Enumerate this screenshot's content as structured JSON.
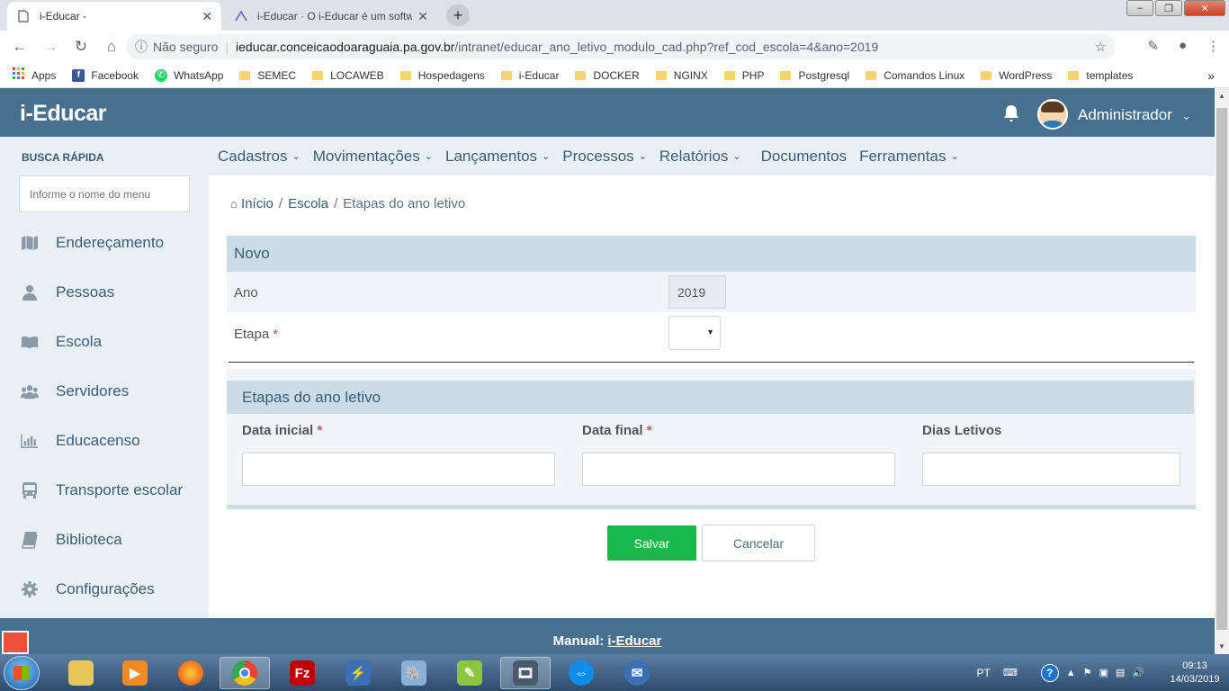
{
  "browser": {
    "tabs": [
      {
        "title": "i-Educar -"
      },
      {
        "title": "i-Educar · O i-Educar é um softwa"
      }
    ],
    "address": {
      "security_label": "Não seguro",
      "host": "ieducar.conceicaodoaraguaia.pa.gov.br",
      "path": "/intranet/educar_ano_letivo_modulo_cad.php?ref_cod_escola=4&ano=2019"
    },
    "bookmarks": [
      "Apps",
      "Facebook",
      "WhatsApp",
      "SEMEC",
      "LOCAWEB",
      "Hospedagens",
      "i-Educar",
      "DOCKER",
      "NGINX",
      "PHP",
      "Postgresql",
      "Comandos Linux",
      "WordPress",
      "templates"
    ]
  },
  "app": {
    "logo": "i-Educar",
    "user_name": "Administrador"
  },
  "sidebar": {
    "search_label": "BUSCA RÁPIDA",
    "search_placeholder": "Informe o nome do menu",
    "items": [
      {
        "label": "Endereçamento",
        "icon": "map-icon"
      },
      {
        "label": "Pessoas",
        "icon": "person-icon"
      },
      {
        "label": "Escola",
        "icon": "book-icon"
      },
      {
        "label": "Servidores",
        "icon": "users-icon"
      },
      {
        "label": "Educacenso",
        "icon": "bar-chart-icon"
      },
      {
        "label": "Transporte escolar",
        "icon": "bus-icon"
      },
      {
        "label": "Biblioteca",
        "icon": "library-book-icon"
      },
      {
        "label": "Configurações",
        "icon": "gear-icon"
      }
    ]
  },
  "menu": [
    "Cadastros",
    "Movimentações",
    "Lançamentos",
    "Processos",
    "Relatórios",
    "Documentos",
    "Ferramentas"
  ],
  "breadcrumb": {
    "home": "Início",
    "level1": "Escola",
    "current": "Etapas do ano letivo"
  },
  "form": {
    "section_title": "Novo",
    "ano_label": "Ano",
    "ano_value": "2019",
    "etapa_label": "Etapa",
    "required_mark": "*",
    "etapas_title": "Etapas do ano letivo",
    "col_data_inicial": "Data inicial",
    "col_data_final": "Data final",
    "col_dias_letivos": "Dias Letivos",
    "save_label": "Salvar",
    "cancel_label": "Cancelar"
  },
  "footer": {
    "prefix": "Manual:",
    "link": "i-Educar"
  },
  "taskbar": {
    "lang": "PT",
    "time": "09:13",
    "date": "14/03/2019"
  },
  "colors": {
    "header": "#47708e",
    "sidebar_bg": "#e9f0f5",
    "section_header": "#ccdce7",
    "save_button": "#18b94a",
    "required": "#d9534f"
  }
}
